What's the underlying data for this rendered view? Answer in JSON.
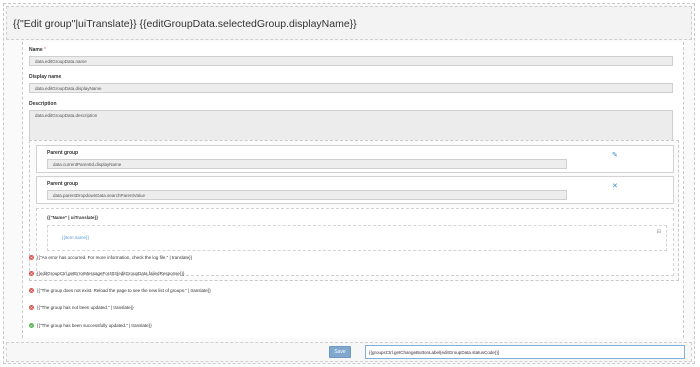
{
  "header": {
    "title": "{{\"Edit group\"|uiTranslate}} {{editGroupData.selectedGroup.displayName}}"
  },
  "form": {
    "name": {
      "label": "Name",
      "required_mark": "*",
      "value": "data.editGroupData.name"
    },
    "display_name": {
      "label": "Display name",
      "value": "data.editGroupData.displayName"
    },
    "description": {
      "label": "Description",
      "value": "data.editGroupData.description"
    }
  },
  "parent_group_current": {
    "label": "Parent group",
    "value": "data.currentParentId.displayName",
    "icon": "pencil-icon"
  },
  "parent_group_search": {
    "label": "Parent group",
    "value": "data.parentDropdownData.searchParentValue",
    "icon": "close-icon"
  },
  "items_panel": {
    "header": "{{\"Name\" | uiTranslate}}",
    "item": "{{item.name}}"
  },
  "messages": [
    {
      "type": "error",
      "text": "{{\"An error has occurred. For more information, check the log file.\" | translate}}"
    },
    {
      "type": "error",
      "text": "{{editGroupCtrl.getErrorMessageFor403(editGroupData.failedResponse)}}"
    },
    {
      "type": "error",
      "text": "{{\"The group does not exist. Reload the page to see the new list of groups.\" | translate}}"
    },
    {
      "type": "error",
      "text": "{{\"The group has not been updated.\" | translate}}"
    },
    {
      "type": "success",
      "text": "{{\"The group has been successfully updated.\" | translate}}"
    }
  ],
  "footer": {
    "save_label": "Save",
    "status_text": "{{groupsCtrl.getChangeButtonLabel(editGroupData.statusCode)}}"
  },
  "colors": {
    "accent": "#7fa7cf",
    "error": "#d9534f",
    "success": "#5cb85c",
    "link": "#3c8dc5"
  }
}
